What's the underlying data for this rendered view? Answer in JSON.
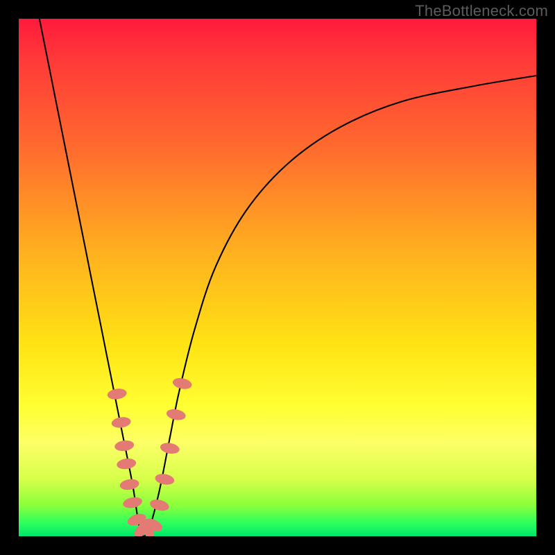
{
  "watermark": "TheBottleneck.com",
  "colors": {
    "frame": "#000000",
    "gradient_top": "#ff1a3c",
    "gradient_mid": "#ffe314",
    "gradient_bottom": "#00e66a",
    "curve": "#000000",
    "bead": "#e47a74"
  },
  "chart_data": {
    "type": "line",
    "title": "",
    "xlabel": "",
    "ylabel": "",
    "xlim": [
      0,
      100
    ],
    "ylim": [
      0,
      100
    ],
    "note": "No axis ticks, labels, or numeric annotations are rendered in the image; values below are geometric estimates of the plotted curve in percent-of-plot coordinates (x rightward, y upward from bottom of colored area). The chart depicts a V-shaped bottleneck curve with its minimum near x≈24.",
    "series": [
      {
        "name": "bottleneck-curve",
        "x": [
          4,
          6,
          8,
          10,
          12,
          14,
          16,
          18,
          20,
          22,
          23.5,
          25,
          27,
          29,
          31,
          34,
          38,
          44,
          52,
          62,
          74,
          88,
          100
        ],
        "y": [
          100,
          90,
          80,
          70,
          60,
          50,
          40,
          30,
          20,
          10,
          1,
          1,
          8,
          18,
          28,
          40,
          52,
          63,
          72,
          79,
          84,
          87,
          89
        ]
      }
    ],
    "markers": {
      "name": "beads",
      "note": "Salmon elliptical markers clustered near the valley of the curve.",
      "points": [
        {
          "x": 19.0,
          "y": 27.5
        },
        {
          "x": 19.8,
          "y": 22.0
        },
        {
          "x": 20.4,
          "y": 17.5
        },
        {
          "x": 20.8,
          "y": 14.0
        },
        {
          "x": 21.4,
          "y": 10.0
        },
        {
          "x": 22.0,
          "y": 6.5
        },
        {
          "x": 22.8,
          "y": 3.2
        },
        {
          "x": 23.8,
          "y": 1.3
        },
        {
          "x": 25.0,
          "y": 1.3
        },
        {
          "x": 26.0,
          "y": 2.2
        },
        {
          "x": 27.2,
          "y": 6.0
        },
        {
          "x": 28.2,
          "y": 11.0
        },
        {
          "x": 29.2,
          "y": 17.0
        },
        {
          "x": 30.4,
          "y": 23.5
        },
        {
          "x": 31.6,
          "y": 29.5
        }
      ]
    }
  }
}
